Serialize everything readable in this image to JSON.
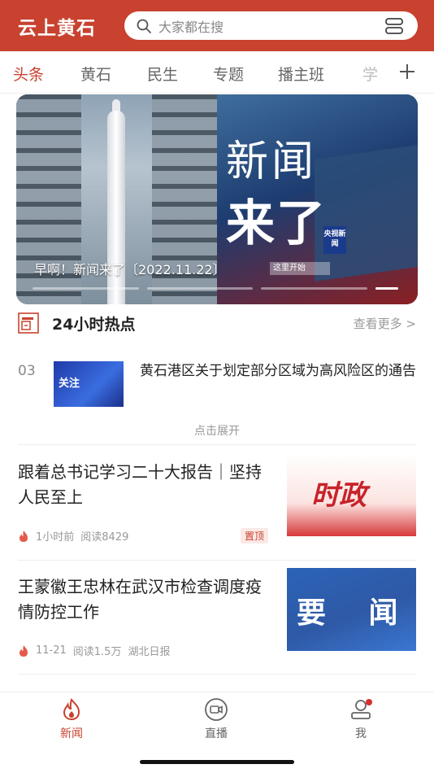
{
  "header": {
    "app_title": "云上黄石",
    "search_placeholder": "大家都在搜",
    "brand_color": "#c8422f"
  },
  "tabs": [
    {
      "label": "头条",
      "active": true
    },
    {
      "label": "黄石",
      "active": false
    },
    {
      "label": "民生",
      "active": false
    },
    {
      "label": "专题",
      "active": false
    },
    {
      "label": "播主班",
      "active": false
    },
    {
      "label": "学",
      "active": false
    }
  ],
  "banner": {
    "caption": "早啊！新闻来了〔2022.11.22〕",
    "chip": "这里开始",
    "headline_line1": "新闻",
    "headline_line2": "来了",
    "badge": "央视新闻"
  },
  "hot": {
    "title": "24小时热点",
    "more": "查看更多 >",
    "item": {
      "rank": "03",
      "thumb_text": "关注",
      "title": "黄石港区关于划定部分区域为高风险区的通告"
    },
    "expand": "点击展开"
  },
  "articles": [
    {
      "title": "跟着总书记学习二十大报告｜坚持人民至上",
      "time": "1小时前",
      "reads": "阅读8429",
      "source": "",
      "badge": "置顶",
      "thumb_text": "时政"
    },
    {
      "title": "王蒙徽王忠林在武汉市检查调度疫情防控工作",
      "time": "11-21",
      "reads": "阅读1.5万",
      "source": "湖北日报",
      "badge": "",
      "thumb_text": "要 闻"
    }
  ],
  "bottom_nav": [
    {
      "label": "新闻",
      "icon": "fire-icon",
      "active": true
    },
    {
      "label": "直播",
      "icon": "video-icon",
      "active": false
    },
    {
      "label": "我",
      "icon": "user-icon",
      "active": false
    }
  ]
}
